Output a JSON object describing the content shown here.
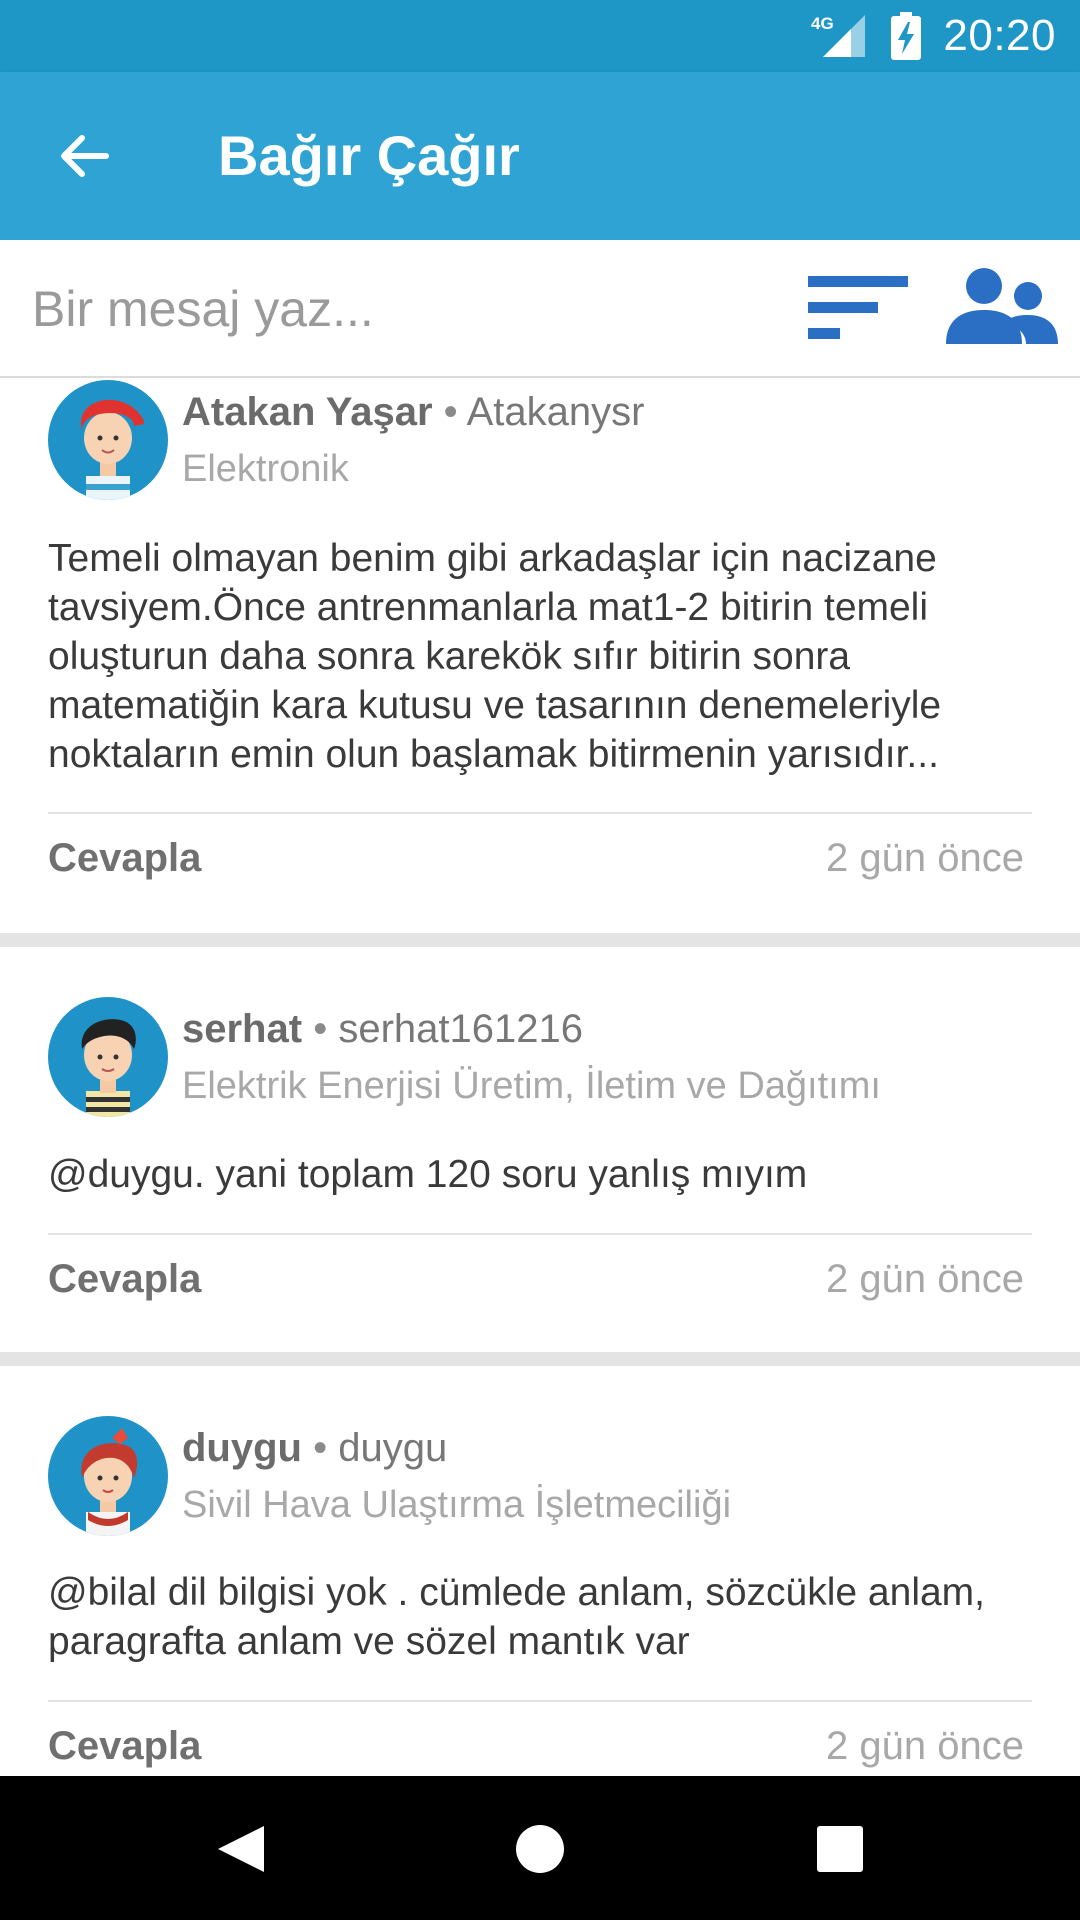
{
  "status_bar": {
    "network": "4G",
    "time": "20:20"
  },
  "app_bar": {
    "title": "Bağır Çağır"
  },
  "composer": {
    "placeholder": "Bir mesaj yaz..."
  },
  "posts": [
    {
      "name": "Atakan Yaşar",
      "handle": "Atakanysr",
      "department": "Elektronik",
      "body": "Temeli olmayan benim gibi arkadaşlar için nacizane tavsiyem.Önce antrenmanlarla mat1-2 bitirin temeli oluşturun daha sonra karekök sıfır bitirin sonra matematiğin kara kutusu ve tasarının denemeleriyle noktaların emin olun başlamak bitirmenin yarısıdır...",
      "reply_label": "Cevapla",
      "time_ago": "2 gün önce"
    },
    {
      "name": "serhat",
      "handle": "serhat161216",
      "department": "Elektrik Enerjisi Üretim, İletim ve Dağıtımı",
      "body": "@duygu. yani toplam 120 soru yanlış mıyım",
      "reply_label": "Cevapla",
      "time_ago": "2 gün önce"
    },
    {
      "name": "duygu",
      "handle": "duygu",
      "department": "Sivil Hava Ulaştırma İşletmeciliği",
      "body": "@bilal dil bilgisi yok . cümlede anlam, sözcükle anlam, paragrafta anlam ve sözel mantık var",
      "reply_label": "Cevapla",
      "time_ago": "2 gün önce"
    }
  ],
  "colors": {
    "status_bar": "#1e97c7",
    "app_bar": "#2fa3d3",
    "icon_blue": "#2a6fc4",
    "avatar_bg": "#1f93c8"
  },
  "icons": [
    "back-arrow-icon",
    "filter-sort-icon",
    "users-group-icon",
    "network-signal-icon",
    "battery-charging-icon",
    "nav-back-icon",
    "nav-home-icon",
    "nav-recents-icon"
  ]
}
